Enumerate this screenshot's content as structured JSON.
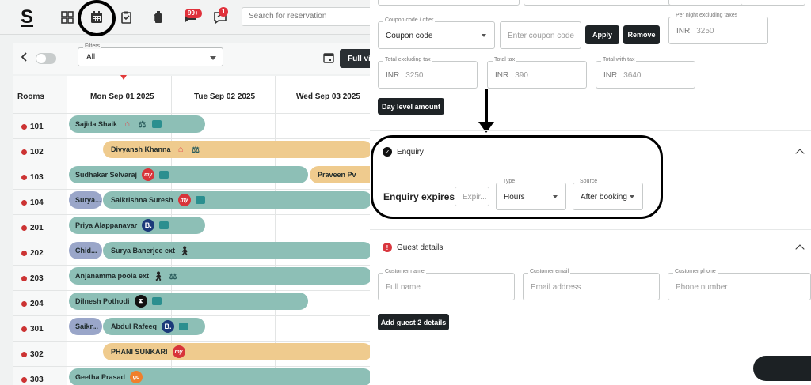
{
  "app": {
    "logo": "S"
  },
  "nav": {
    "badges": {
      "messages": "99+",
      "notes": "1"
    },
    "search_placeholder": "Search for reservation"
  },
  "filters": {
    "label": "Filters",
    "value": "All",
    "full_view_label": "Full vi"
  },
  "grid": {
    "rooms_header": "Rooms",
    "days": [
      "Mon Sep 01 2025",
      "Tue Sep 02 2025",
      "Wed Sep 03 2025"
    ],
    "rooms": [
      "101",
      "102",
      "103",
      "104",
      "201",
      "202",
      "203",
      "204",
      "301",
      "302",
      "303"
    ]
  },
  "bookings": [
    {
      "guest": "Sajida Shaik",
      "room": "101",
      "source_icon": "airbnb-icon",
      "extra_icons": [
        "scale-icon",
        "message-icon"
      ],
      "color": "#8dbfb6"
    },
    {
      "guest": "Divyansh Khanna",
      "room": "102",
      "source_icon": "airbnb-icon",
      "extra_icons": [
        "scale-icon"
      ],
      "color": "#efcb8e"
    },
    {
      "guest": "Sudhakar Selvaraj",
      "room": "103",
      "source_icon": "makemytrip-icon",
      "extra_icons": [
        "message-icon"
      ],
      "color": "#8dbfb6"
    },
    {
      "guest": "Praveen Pv",
      "room": "103",
      "source_icon": "",
      "extra_icons": [],
      "color": "#efcb8e"
    },
    {
      "guest": "Surya...",
      "room": "104",
      "source_icon": "",
      "extra_icons": [],
      "color": "#9aa6c9"
    },
    {
      "guest": "Saikrishna Suresh",
      "room": "104",
      "source_icon": "makemytrip-icon",
      "extra_icons": [
        "message-icon"
      ],
      "color": "#8dbfb6"
    },
    {
      "guest": "Priya Alappanavar",
      "room": "201",
      "source_icon": "booking-icon",
      "extra_icons": [
        "message-icon"
      ],
      "color": "#8dbfb6"
    },
    {
      "guest": "Chid...",
      "room": "202",
      "source_icon": "",
      "extra_icons": [],
      "color": "#9aa6c9"
    },
    {
      "guest": "Surya Banerjee ext",
      "room": "202",
      "source_icon": "walk-in-icon",
      "extra_icons": [],
      "color": "#8dbfb6"
    },
    {
      "guest": "Anjanamma poola ext",
      "room": "203",
      "source_icon": "walk-in-icon",
      "extra_icons": [
        "scale-icon"
      ],
      "color": "#8dbfb6"
    },
    {
      "guest": "Dilnesh Pothodi",
      "room": "204",
      "source_icon": "hourly-icon",
      "extra_icons": [
        "message-icon"
      ],
      "color": "#8dbfb6"
    },
    {
      "guest": "Saikr...",
      "room": "301",
      "source_icon": "",
      "extra_icons": [],
      "color": "#9aa6c9"
    },
    {
      "guest": "Abdul Rafeeq",
      "room": "301",
      "source_icon": "booking-icon",
      "extra_icons": [
        "message-icon"
      ],
      "color": "#8dbfb6"
    },
    {
      "guest": "PHANI SUNKARI",
      "room": "302",
      "source_icon": "makemytrip-icon",
      "extra_icons": [],
      "color": "#efcb8e"
    },
    {
      "guest": "Geetha Prasad",
      "room": "303",
      "source_icon": "goibibo-icon",
      "extra_icons": [],
      "color": "#8dbfb6"
    }
  ],
  "icon_glyphs": {
    "mmt": "my",
    "booking": "B.",
    "goibibo": "go"
  },
  "panel": {
    "coupon_label": "Coupon code / offer",
    "coupon_value": "Coupon code",
    "coupon_placeholder": "Enter coupon code",
    "apply_label": "Apply",
    "remove_label": "Remove",
    "per_night_label": "Per night excluding taxes",
    "per_night_currency": "INR",
    "per_night_value": "3250",
    "total_excl_label": "Total excluding tax",
    "total_excl_currency": "INR",
    "total_excl_value": "3250",
    "total_tax_label": "Total tax",
    "total_tax_currency": "INR",
    "total_tax_value": "390",
    "total_with_label": "Total with tax",
    "total_with_currency": "INR",
    "total_with_value": "3640",
    "day_level_label": "Day level amount",
    "enquiry_title": "Enquiry",
    "enquiry_expires_label": "Enquiry expires in",
    "expiry_placeholder": "Expir...",
    "type_label": "Type",
    "type_value": "Hours",
    "source_label": "Source",
    "source_value": "After booking",
    "guest_title": "Guest details",
    "customer_name_label": "Customer name",
    "customer_name_placeholder": "Full name",
    "customer_email_label": "Customer email",
    "customer_email_placeholder": "Email address",
    "customer_phone_label": "Customer phone",
    "customer_phone_placeholder": "Phone number",
    "add_guest_label": "Add guest 2 details"
  },
  "colors": {
    "accent_dark": "#1e2326",
    "today_line": "#e23a3a",
    "teal": "#8dbfb6",
    "gold": "#efcb8e",
    "lavender": "#9aa6c9"
  }
}
